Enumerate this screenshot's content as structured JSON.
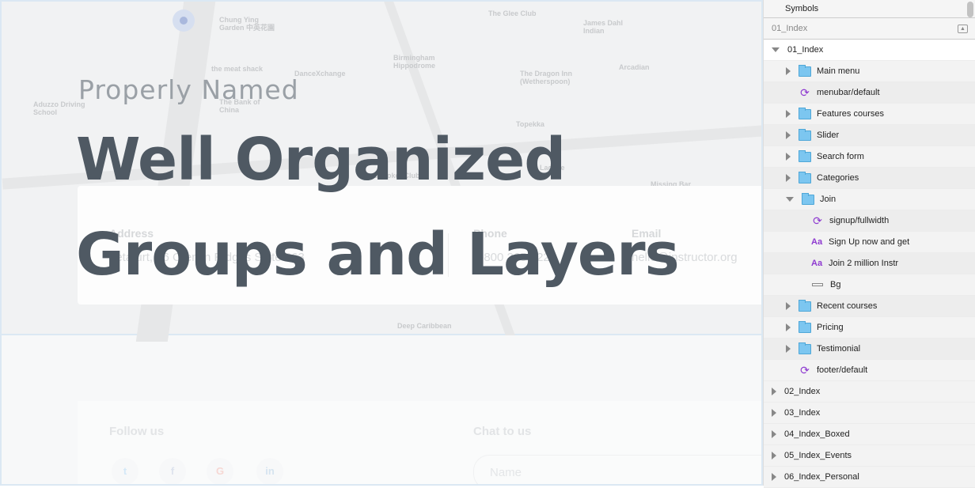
{
  "canvas": {
    "subtitle": "Properly Named",
    "title_line1": "Well Organized",
    "title_line2": "Groups and Layers",
    "map_labels": [
      "Chung Ying Garden 中英花園",
      "The Glee Club",
      "James Dahl Indian",
      "Birmingham Hippodrome",
      "the meat shack",
      "DanceXchange",
      "The Bank of China",
      "The Dragon Inn (Wetherspoon)",
      "Arcadian",
      "Aduzzo Driving School",
      "Topekka",
      "Lagene",
      "Snooker Club",
      "Missing Bar",
      "Deep Caribbean"
    ],
    "contact": {
      "address_label": "Address",
      "address": "Letafurt, 96 Cremin Ridges Suite 363",
      "phone_label": "Phone",
      "phone": "8-800 265 2222",
      "email_label": "Email",
      "email": "hello@instructor.org"
    },
    "footer": {
      "follow_label": "Follow us",
      "chat_label": "Chat to us",
      "name_placeholder": "Name",
      "social": [
        "twitter",
        "facebook",
        "google",
        "linkedin"
      ]
    }
  },
  "panel": {
    "symbols": "Symbols",
    "page_name": "01_Index",
    "layers": [
      {
        "label": "01_Index",
        "type": "artboard",
        "expanded": true,
        "level": 0
      },
      {
        "label": "Main menu",
        "type": "group",
        "level": 1
      },
      {
        "label": "menubar/default",
        "type": "symbol",
        "level": 1
      },
      {
        "label": "Features courses",
        "type": "group",
        "level": 1
      },
      {
        "label": "Slider",
        "type": "group",
        "level": 1
      },
      {
        "label": "Search form",
        "type": "group",
        "level": 1
      },
      {
        "label": "Categories",
        "type": "group",
        "level": 1
      },
      {
        "label": "Join",
        "type": "group",
        "expanded": true,
        "level": 1
      },
      {
        "label": "signup/fullwidth",
        "type": "symbol",
        "level": 2
      },
      {
        "label": "Sign Up now and get",
        "type": "text",
        "level": 2
      },
      {
        "label": "Join 2 million Instr",
        "type": "text",
        "level": 2
      },
      {
        "label": "Bg",
        "type": "rectangle",
        "level": 2
      },
      {
        "label": "Recent courses",
        "type": "group",
        "level": 1
      },
      {
        "label": "Pricing",
        "type": "group",
        "level": 1
      },
      {
        "label": "Testimonial",
        "type": "group",
        "level": 1
      },
      {
        "label": "footer/default",
        "type": "symbol",
        "level": 1
      },
      {
        "label": "02_Index",
        "type": "artboard",
        "level": 0
      },
      {
        "label": "03_Index",
        "type": "artboard",
        "level": 0
      },
      {
        "label": "04_Index_Boxed",
        "type": "artboard",
        "level": 0
      },
      {
        "label": "05_Index_Events",
        "type": "artboard",
        "level": 0
      },
      {
        "label": "06_Index_Personal",
        "type": "artboard",
        "level": 0
      }
    ]
  }
}
